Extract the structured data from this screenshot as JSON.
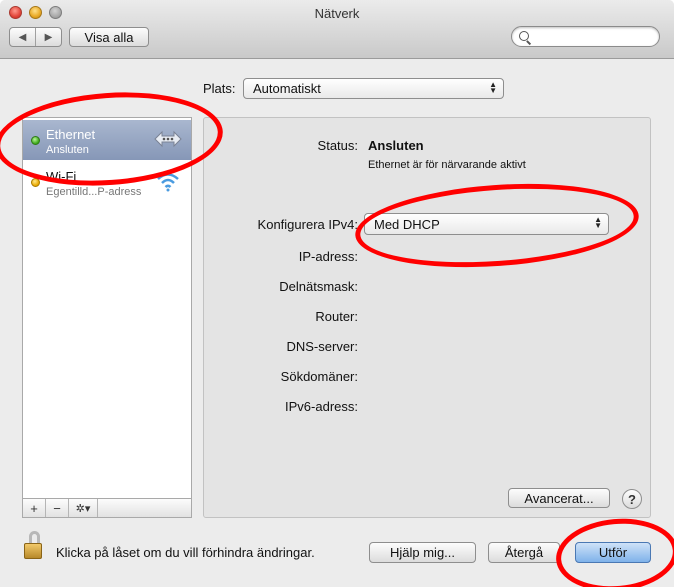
{
  "window": {
    "title": "Nätverk"
  },
  "toolbar": {
    "back": "◀",
    "forward": "▶",
    "show_all": "Visa alla",
    "search_placeholder": ""
  },
  "location": {
    "label": "Plats:",
    "value": "Automatiskt"
  },
  "services": [
    {
      "name": "Ethernet",
      "status": "Ansluten",
      "dot": "green",
      "icon": "ethernet-arrows-icon",
      "selected": true
    },
    {
      "name": "Wi-Fi",
      "status": "Egentilld...P-adress",
      "dot": "yellow",
      "icon": "wifi-icon",
      "selected": false
    }
  ],
  "sidebar_controls": {
    "add": "+",
    "remove": "−",
    "action": "✲▾"
  },
  "detail": {
    "status_label": "Status:",
    "status_value": "Ansluten",
    "status_desc": "Ethernet är för närvarande aktivt",
    "configure_label": "Konfigurera IPv4:",
    "configure_value": "Med DHCP",
    "ip_label": "IP-adress:",
    "subnet_label": "Delnätsmask:",
    "router_label": "Router:",
    "dns_label": "DNS-server:",
    "search_domains_label": "Sökdomäner:",
    "ipv6_label": "IPv6-adress:",
    "advanced": "Avancerat...",
    "help": "?"
  },
  "footer": {
    "lock_text": "Klicka på låset om du vill förhindra ändringar.",
    "assist": "Hjälp mig...",
    "revert": "Återgå",
    "apply": "Utför"
  },
  "colors": {
    "annotation": "#ff0000",
    "selection": "#8c9dbc",
    "status_green": "#3faa1c",
    "status_yellow": "#e9a800"
  }
}
